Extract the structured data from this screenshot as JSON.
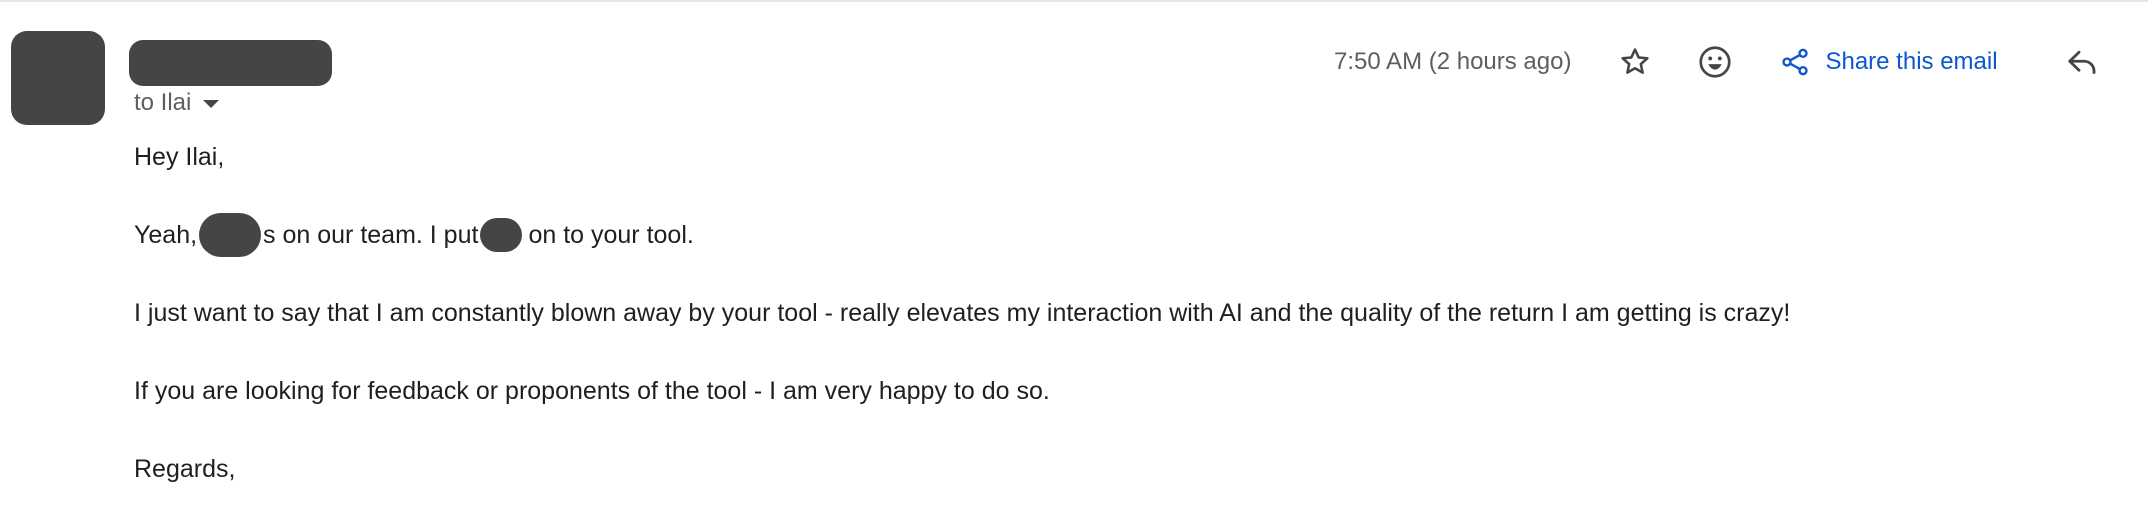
{
  "email": {
    "recipient_label": "to Ilai",
    "timestamp": "7:50 AM (2 hours ago)",
    "share_label": "Share this email",
    "icons": {
      "star": "star-outline-icon",
      "emoji": "emoji-smile-icon",
      "share": "share-icon",
      "reply": "reply-icon",
      "recipient_menu": "caret-down-icon"
    },
    "body": {
      "greeting": "Hey Ilai,",
      "p1_start": "Yeah,",
      "p1_mid": "s on our team. I put",
      "p1_end": "on to your tool.",
      "p2": "I just want to say that I am constantly blown away by your tool - really elevates my interaction with AI and the quality of the return I am getting is crazy!",
      "p3": "If you are looking for feedback or proponents of the tool - I am very happy to do so.",
      "signoff": "Regards,"
    }
  },
  "colors": {
    "redaction": "#454545",
    "link": "#0b57d0",
    "secondary_text": "#5e5e5e",
    "primary_text": "#1f1f1f"
  }
}
